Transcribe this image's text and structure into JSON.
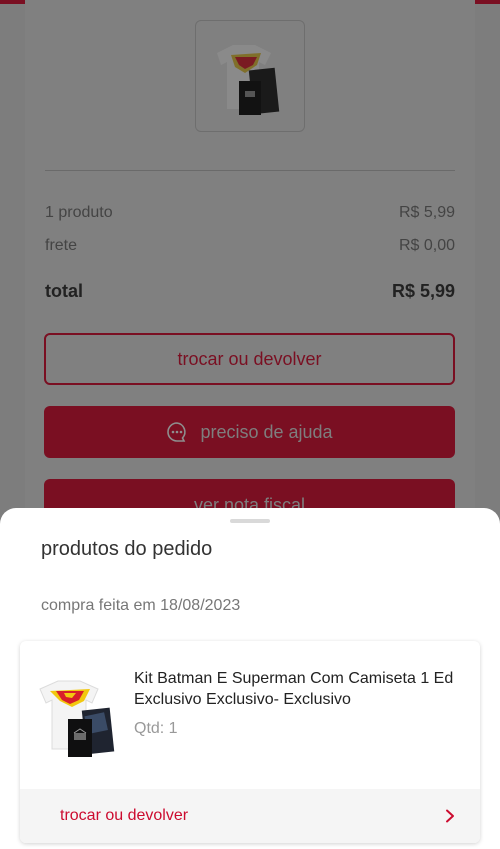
{
  "background_page": {
    "summary": [
      {
        "label": "1 produto",
        "value": "R$ 5,99"
      },
      {
        "label": "frete",
        "value": "R$ 0,00"
      }
    ],
    "total": {
      "label": "total",
      "value": "R$ 5,99"
    },
    "exchange_button": "trocar ou devolver",
    "help_button": "preciso de ajuda",
    "invoice_button": "ver nota fiscal"
  },
  "sheet": {
    "title": "produtos do pedido",
    "purchase_date": "compra feita em 18/08/2023",
    "product": {
      "name": "Kit Batman E Superman Com Camiseta  1 Ed  Exclusivo  Exclusivo- Exclusivo",
      "quantity": "Qtd: 1",
      "action_label": "trocar ou devolver",
      "action_icon": "chevron-right-icon"
    }
  },
  "colors": {
    "brand": "#cc0b2f",
    "overlay": "#7d7d7d"
  }
}
